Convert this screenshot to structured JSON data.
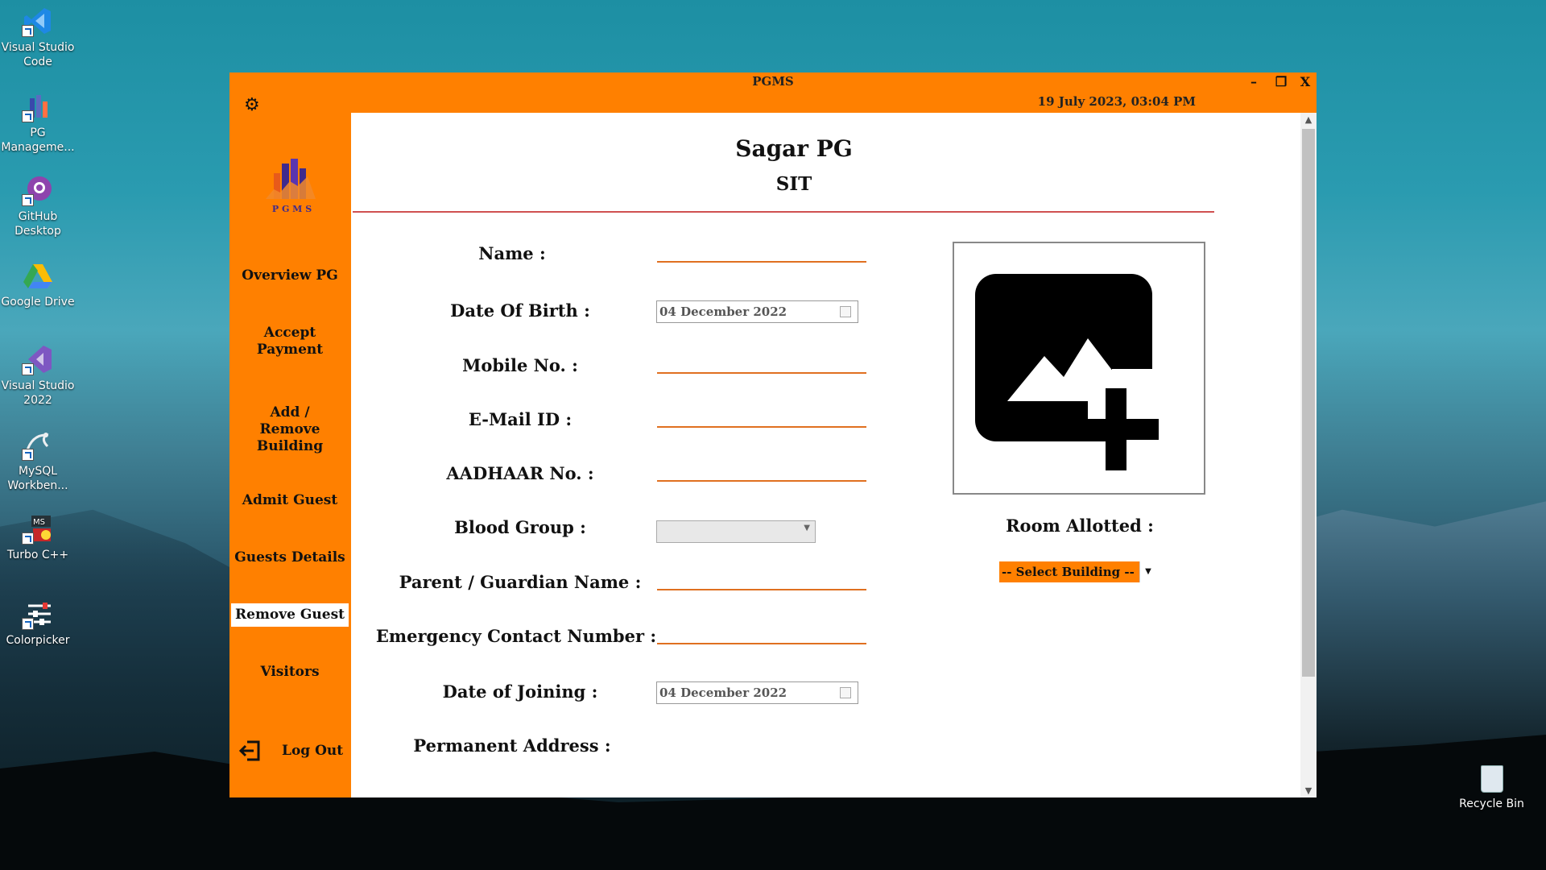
{
  "desktop": {
    "icons": [
      {
        "label": "Visual Studio Code",
        "name": "vscode"
      },
      {
        "label": "PG Manageme...",
        "name": "pg-management"
      },
      {
        "label": "GitHub Desktop",
        "name": "github-desktop"
      },
      {
        "label": "Google Drive",
        "name": "google-drive"
      },
      {
        "label": "Visual Studio 2022",
        "name": "visual-studio"
      },
      {
        "label": "MySQL Workben...",
        "name": "mysql-workbench"
      },
      {
        "label": "Turbo C++",
        "name": "turbo-cpp"
      },
      {
        "label": "Colorpicker",
        "name": "colorpicker"
      }
    ],
    "recycle_bin": "Recycle Bin"
  },
  "window": {
    "title": "PGMS",
    "datetime": "19 July 2023,  03:04 PM",
    "controls": {
      "minimize": "–",
      "maximize": "❐",
      "close": "X"
    },
    "accent": "#ff8000"
  },
  "sidebar": {
    "logo_text": "P G M S",
    "items": [
      {
        "label": "Overview PG"
      },
      {
        "label": "Accept Payment"
      },
      {
        "label": "Add / Remove Building"
      },
      {
        "label": "Admit Guest"
      },
      {
        "label": "Guests Details"
      },
      {
        "label": "Remove Guest",
        "active": true
      },
      {
        "label": "Visitors"
      }
    ],
    "logout": "Log Out"
  },
  "main": {
    "pg_name": "Sagar PG",
    "pg_code": "SIT",
    "form": {
      "name_label": "Name :",
      "dob_label": "Date Of Birth :",
      "dob_value": "04 December  2022",
      "mobile_label": "Mobile No. :",
      "email_label": "E-Mail ID :",
      "aadhaar_label": "AADHAAR No. :",
      "blood_label": "Blood Group :",
      "parent_label": "Parent / Guardian Name :",
      "emergency_label": "Emergency Contact Number :",
      "doj_label": "Date of Joining :",
      "doj_value": "04 December  2022",
      "address_label": "Permanent Address :"
    },
    "room_label": "Room Allotted :",
    "building_select": "-- Select Building --"
  }
}
